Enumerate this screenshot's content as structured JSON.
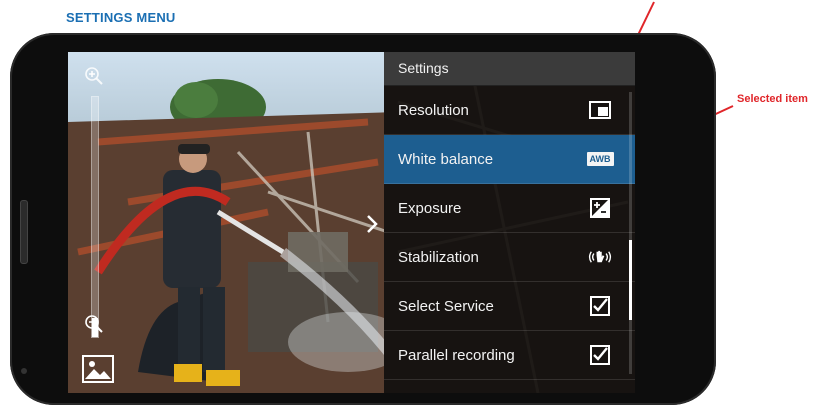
{
  "document": {
    "title": "SETTINGS MENU",
    "callout_label": "Selected item"
  },
  "camera": {
    "zoom_level": 0.08,
    "icons": {
      "zoom_in": "zoom-in-icon",
      "zoom_out": "zoom-out-icon",
      "gallery": "gallery-icon",
      "panel_toggle": "chevron-right-icon"
    }
  },
  "settings": {
    "header": "Settings",
    "items": [
      {
        "label": "Resolution",
        "icon": "resolution-icon",
        "selected": false
      },
      {
        "label": "White balance",
        "icon": "awb-icon",
        "icon_text": "AWB",
        "selected": true
      },
      {
        "label": "Exposure",
        "icon": "exposure-icon",
        "selected": false
      },
      {
        "label": "Stabilization",
        "icon": "stabilization-icon",
        "selected": false
      },
      {
        "label": "Select Service",
        "icon": "checkbox-checked-icon",
        "selected": false
      },
      {
        "label": "Parallel recording",
        "icon": "checkbox-checked-icon",
        "selected": false
      }
    ]
  },
  "colors": {
    "title_blue": "#1b6fb3",
    "callout_red": "#e0262a",
    "selected_bg": "#1d5e90",
    "header_bg": "#3b3b3b"
  }
}
